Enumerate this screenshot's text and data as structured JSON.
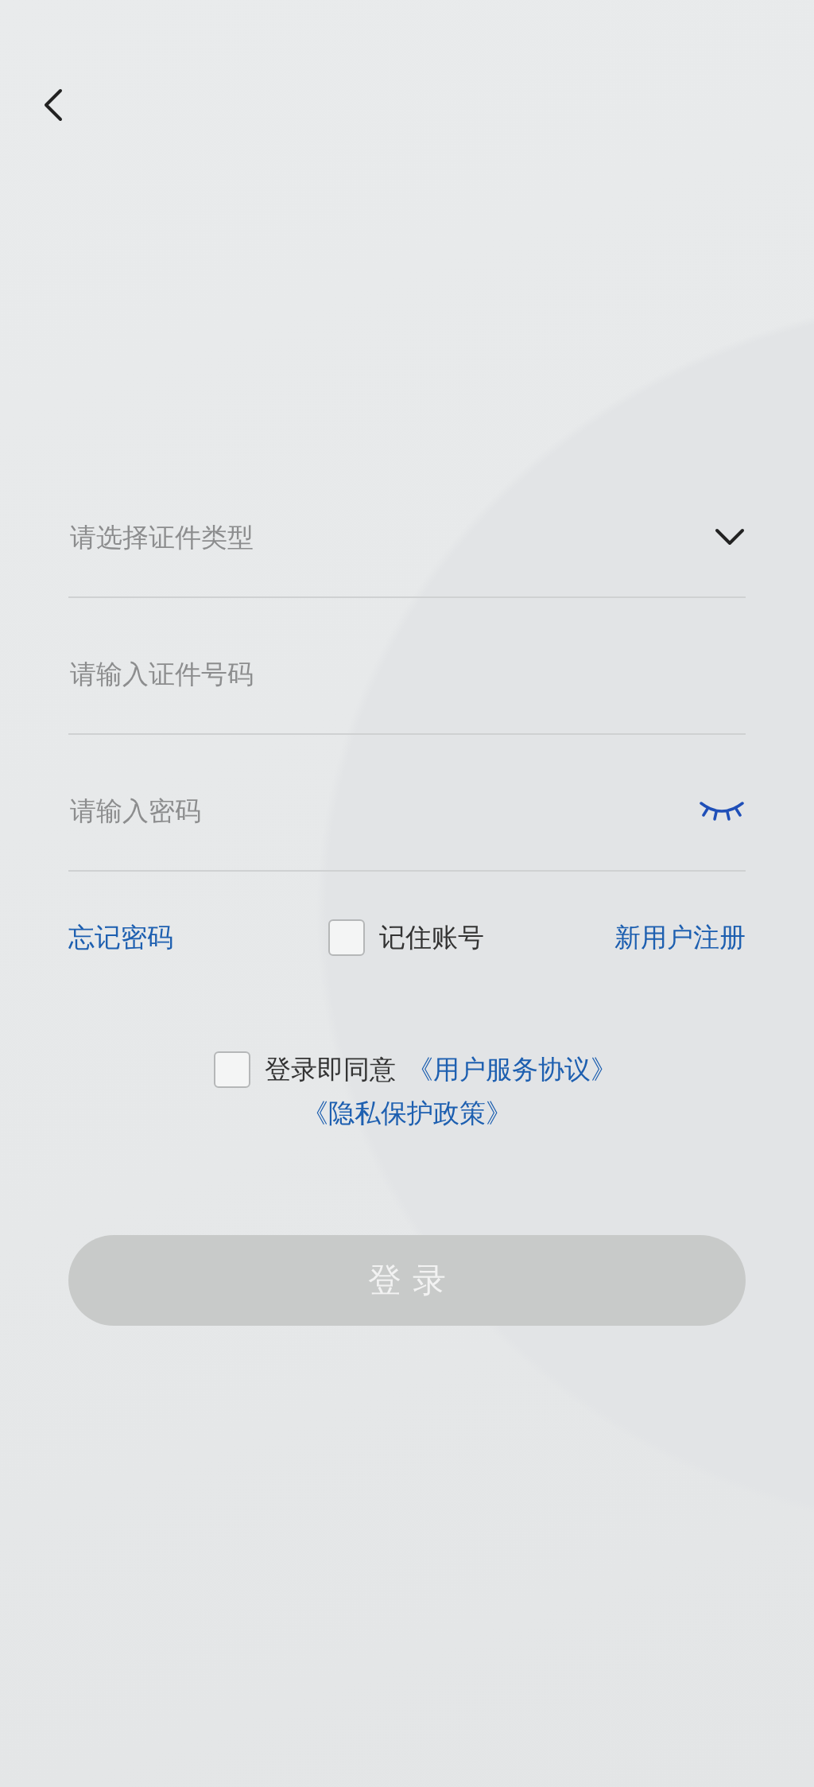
{
  "fields": [
    {
      "kind": "select",
      "placeholder": "请选择证件类型"
    },
    {
      "kind": "text",
      "placeholder": "请输入证件号码"
    },
    {
      "kind": "password",
      "placeholder": "请输入密码",
      "password_visible": false
    }
  ],
  "options": {
    "forgot_link": "忘记密码",
    "remember": {
      "label": "记住账号",
      "checked": false
    },
    "register_link": "新用户注册"
  },
  "agreement": {
    "checked": false,
    "text": "登录即同意",
    "links": [
      "《用户服务协议》",
      "《隐私保护政策》"
    ]
  },
  "login_button": {
    "label": "登 录",
    "disabled": true
  }
}
